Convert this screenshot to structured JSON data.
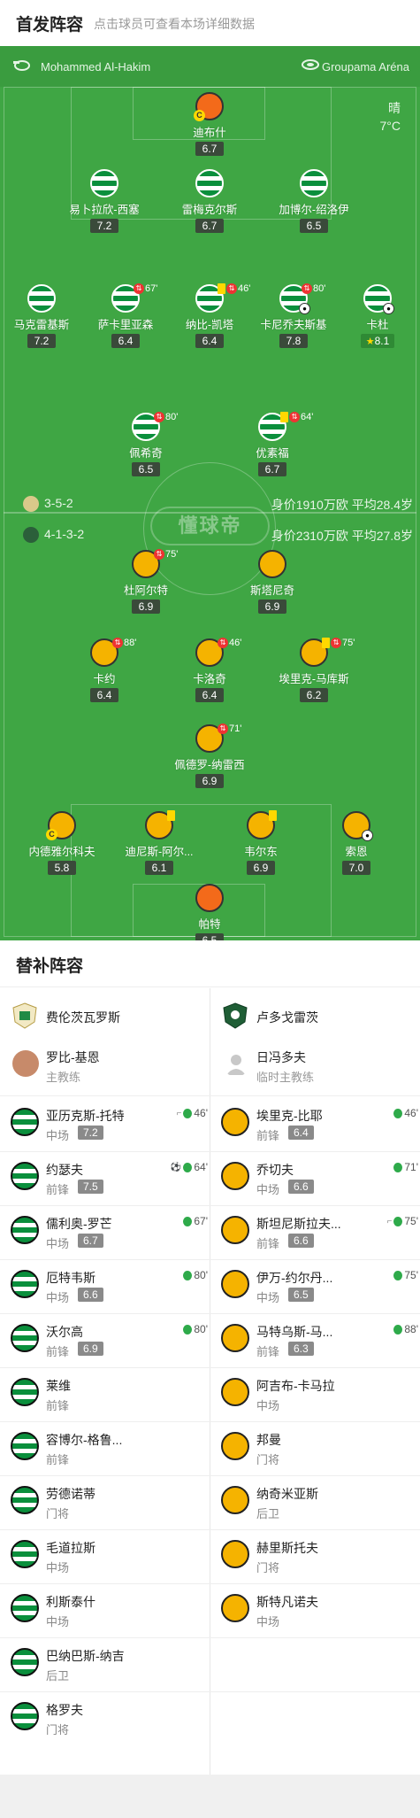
{
  "header": {
    "title": "首发阵容",
    "subtitle": "点击球员可查看本场详细数据"
  },
  "match_info": {
    "referee": "Mohammed Al-Hakim",
    "venue": "Groupama Aréna",
    "weather": "晴",
    "temperature": "7°C"
  },
  "brand": "懂球帝",
  "home_formation": {
    "formation": "3-5-2",
    "value": "身价1910万欧 平均28.4岁"
  },
  "away_formation": {
    "formation": "4-1-3-2",
    "value": "身价2310万欧 平均27.8岁"
  },
  "home_players": [
    {
      "name": "迪布什",
      "rating": "6.7",
      "kit": "gk",
      "captain": true
    },
    {
      "name": "易卜拉欣-西塞",
      "rating": "7.2",
      "kit": "home"
    },
    {
      "name": "雷梅克尔斯",
      "rating": "6.7",
      "kit": "home"
    },
    {
      "name": "加博尔-绍洛伊",
      "rating": "6.5",
      "kit": "home"
    },
    {
      "name": "马克雷基斯",
      "rating": "7.2",
      "kit": "home"
    },
    {
      "name": "萨卡里亚森",
      "rating": "6.4",
      "kit": "home",
      "sub_time": "67'"
    },
    {
      "name": "纳比-凯塔",
      "rating": "6.4",
      "kit": "home",
      "sub_time": "46'",
      "yellow": true
    },
    {
      "name": "卡尼乔夫斯基",
      "rating": "7.8",
      "kit": "home",
      "sub_time": "80'",
      "ball": true
    },
    {
      "name": "卡杜",
      "rating": "8.1",
      "kit": "home",
      "ball": true,
      "star": true
    },
    {
      "name": "佩希奇",
      "rating": "6.5",
      "kit": "home",
      "sub_time": "80'"
    },
    {
      "name": "优素福",
      "rating": "6.7",
      "kit": "home",
      "sub_time": "64'",
      "yellow": true
    }
  ],
  "away_players": [
    {
      "name": "杜阿尔特",
      "rating": "6.9",
      "kit": "away",
      "sub_time": "75'"
    },
    {
      "name": "斯塔尼奇",
      "rating": "6.9",
      "kit": "away"
    },
    {
      "name": "卡约",
      "rating": "6.4",
      "kit": "away",
      "sub_time": "88'"
    },
    {
      "name": "卡洛奇",
      "rating": "6.4",
      "kit": "away",
      "sub_time": "46'"
    },
    {
      "name": "埃里克-马库斯",
      "rating": "6.2",
      "kit": "away",
      "sub_time": "75'",
      "yellow": true
    },
    {
      "name": "佩德罗-纳雷西",
      "rating": "6.9",
      "kit": "away",
      "sub_time": "71'"
    },
    {
      "name": "内德雅尔科夫",
      "rating": "5.8",
      "kit": "away",
      "captain": true
    },
    {
      "name": "迪尼斯-阿尔...",
      "rating": "6.1",
      "kit": "away",
      "yellow": true
    },
    {
      "name": "韦尔东",
      "rating": "6.9",
      "kit": "away",
      "yellow": true
    },
    {
      "name": "索恩",
      "rating": "7.0",
      "kit": "away",
      "ball": true
    },
    {
      "name": "帕特",
      "rating": "6.5",
      "kit": "gk"
    }
  ],
  "subs_title": "替补阵容",
  "home_team": {
    "name": "费伦茨瓦罗斯",
    "coach": "罗比-基恩",
    "coach_role": "主教练"
  },
  "away_team": {
    "name": "卢多戈雷茨",
    "coach": "日冯多夫",
    "coach_role": "临时主教练"
  },
  "home_subs": [
    {
      "name": "亚历克斯-托特",
      "pos": "中场",
      "rating": "7.2",
      "time": "46'",
      "icon": "whistle"
    },
    {
      "name": "约瑟夫",
      "pos": "前锋",
      "rating": "7.5",
      "time": "64'",
      "icon": "ball"
    },
    {
      "name": "儒利奥-罗芒",
      "pos": "中场",
      "rating": "6.7",
      "time": "67'"
    },
    {
      "name": "厄特韦斯",
      "pos": "中场",
      "rating": "6.6",
      "time": "80'"
    },
    {
      "name": "沃尔高",
      "pos": "前锋",
      "rating": "6.9",
      "time": "80'"
    },
    {
      "name": "莱维",
      "pos": "前锋"
    },
    {
      "name": "容博尔-格鲁...",
      "pos": "前锋"
    },
    {
      "name": "劳德诺蒂",
      "pos": "门将"
    },
    {
      "name": "毛道拉斯",
      "pos": "中场"
    },
    {
      "name": "利斯泰什",
      "pos": "中场"
    },
    {
      "name": "巴纳巴斯-纳吉",
      "pos": "后卫"
    },
    {
      "name": "格罗夫",
      "pos": "门将"
    }
  ],
  "away_subs": [
    {
      "name": "埃里克-比耶",
      "pos": "前锋",
      "rating": "6.4",
      "time": "46'"
    },
    {
      "name": "乔切夫",
      "pos": "中场",
      "rating": "6.6",
      "time": "71'"
    },
    {
      "name": "斯坦尼斯拉夫...",
      "pos": "前锋",
      "rating": "6.6",
      "time": "75'",
      "icon": "whistle"
    },
    {
      "name": "伊万-约尔丹...",
      "pos": "中场",
      "rating": "6.5",
      "time": "75'"
    },
    {
      "name": "马特乌斯-马...",
      "pos": "前锋",
      "rating": "6.3",
      "time": "88'"
    },
    {
      "name": "阿吉布-卡马拉",
      "pos": "中场"
    },
    {
      "name": "邦曼",
      "pos": "门将"
    },
    {
      "name": "纳奇米亚斯",
      "pos": "后卫"
    },
    {
      "name": "赫里斯托夫",
      "pos": "门将"
    },
    {
      "name": "斯特凡诺夫",
      "pos": "中场"
    }
  ]
}
